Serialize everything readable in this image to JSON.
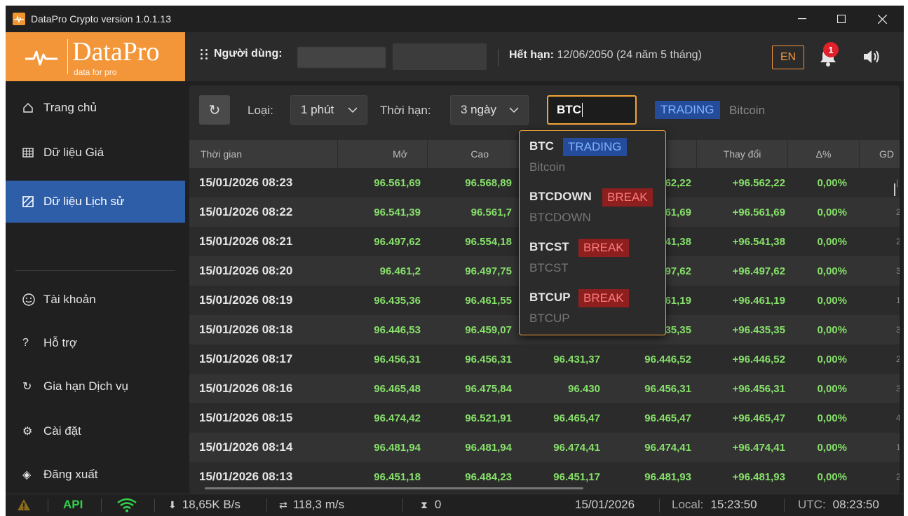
{
  "window": {
    "title": "DataPro Crypto version 1.0.1.13"
  },
  "logo": {
    "brand": "DataPro",
    "tagline": "data for pro"
  },
  "header": {
    "user_label": "Người dùng:",
    "expiry_label": "Hết hạn:",
    "expiry_value": "12/06/2050 (24 năm 5 tháng)",
    "language": "EN",
    "notification_count": "1"
  },
  "sidebar": {
    "items": [
      {
        "label": "Trang chủ",
        "icon": "home-icon"
      },
      {
        "label": "Dữ liệu Giá",
        "icon": "grid-icon"
      },
      {
        "label": "Dữ liệu Lịch sử",
        "icon": "history-icon",
        "active": true
      },
      {
        "label": "Tài khoản",
        "icon": "smiley-icon"
      },
      {
        "label": "Hỗ trợ",
        "icon": "question-icon"
      },
      {
        "label": "Gia hạn Dịch vụ",
        "icon": "renew-icon"
      },
      {
        "label": "Cài đặt",
        "icon": "gear-icon"
      },
      {
        "label": "Đăng xuất",
        "icon": "logout-icon"
      }
    ]
  },
  "toolbar": {
    "type_label": "Loại:",
    "type_value": "1 phút",
    "period_label": "Thời hạn:",
    "period_value": "3 ngày",
    "search_value": "BTC",
    "status_tag": "TRADING",
    "symbol_name": "Bitcoin"
  },
  "table": {
    "columns": [
      "Thời gian",
      "Mở",
      "Cao",
      "",
      "",
      "Thay đổi",
      "Δ%",
      "GD"
    ],
    "rows": [
      {
        "time": "15/01/2026 08:23",
        "open": "96.561,69",
        "high": "96.568,89",
        "low": "",
        "close": "62,22",
        "change": "+96.562,22",
        "pct": "0,00%",
        "gd": "|"
      },
      {
        "time": "15/01/2026 08:22",
        "open": "96.541,39",
        "high": "96.561,7",
        "low": "",
        "close": "61,69",
        "change": "+96.561,69",
        "pct": "0,00%",
        "gd": "2"
      },
      {
        "time": "15/01/2026 08:21",
        "open": "96.497,62",
        "high": "96.554,18",
        "low": "",
        "close": "41,38",
        "change": "+96.541,38",
        "pct": "0,00%",
        "gd": "2"
      },
      {
        "time": "15/01/2026 08:20",
        "open": "96.461,2",
        "high": "96.497,75",
        "low": "",
        "close": "97,62",
        "change": "+96.497,62",
        "pct": "0,00%",
        "gd": "3"
      },
      {
        "time": "15/01/2026 08:19",
        "open": "96.435,36",
        "high": "96.461,55",
        "low": "",
        "close": "461,19",
        "change": "+96.461,19",
        "pct": "0,00%",
        "gd": "1"
      },
      {
        "time": "15/01/2026 08:18",
        "open": "96.446,53",
        "high": "96.459,07",
        "low": "",
        "close": "35,35",
        "change": "+96.435,35",
        "pct": "0,00%",
        "gd": "3"
      },
      {
        "time": "15/01/2026 08:17",
        "open": "96.456,31",
        "high": "96.456,31",
        "low": "96.431,37",
        "close": "96.446,52",
        "change": "+96.446,52",
        "pct": "0,00%",
        "gd": "2"
      },
      {
        "time": "15/01/2026 08:16",
        "open": "96.465,48",
        "high": "96.475,84",
        "low": "96.430",
        "close": "96.456,31",
        "change": "+96.456,31",
        "pct": "0,00%",
        "gd": "3"
      },
      {
        "time": "15/01/2026 08:15",
        "open": "96.474,42",
        "high": "96.521,91",
        "low": "96.465,47",
        "close": "96.465,47",
        "change": "+96.465,47",
        "pct": "0,00%",
        "gd": "4"
      },
      {
        "time": "15/01/2026 08:14",
        "open": "96.481,94",
        "high": "96.481,94",
        "low": "96.474,41",
        "close": "96.474,41",
        "change": "+96.474,41",
        "pct": "0,00%",
        "gd": "1"
      },
      {
        "time": "15/01/2026 08:13",
        "open": "96.451,18",
        "high": "96.484,23",
        "low": "96.451,17",
        "close": "96.481,93",
        "change": "+96.481,93",
        "pct": "0,00%",
        "gd": "2"
      }
    ]
  },
  "dropdown": {
    "items": [
      {
        "symbol": "BTC",
        "tag": "TRADING",
        "tag_type": "trading",
        "name": "Bitcoin"
      },
      {
        "symbol": "BTCDOWN",
        "tag": "BREAK",
        "tag_type": "break",
        "name": "BTCDOWN"
      },
      {
        "symbol": "BTCST",
        "tag": "BREAK",
        "tag_type": "break",
        "name": "BTCST"
      },
      {
        "symbol": "BTCUP",
        "tag": "BREAK",
        "tag_type": "break",
        "name": "BTCUP"
      }
    ]
  },
  "statusbar": {
    "api": "API",
    "download": "18,65K B/s",
    "latency": "118,3 m/s",
    "queue": "0",
    "date": "15/01/2026",
    "local_label": "Local:",
    "local_time": "15:23:50",
    "utc_label": "UTC:",
    "utc_time": "08:23:50"
  },
  "colors": {
    "accent": "#f3963a",
    "active_nav": "#2f5ea8",
    "positive": "#86e06a",
    "trading": "#244c9a",
    "break": "#8e1f1f"
  }
}
